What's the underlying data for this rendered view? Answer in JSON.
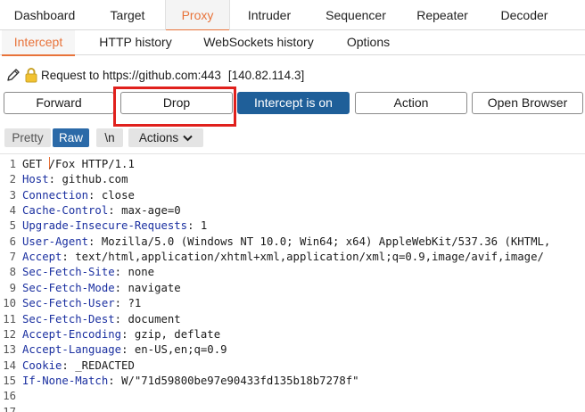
{
  "tabs_primary": [
    {
      "label": "Dashboard"
    },
    {
      "label": "Target"
    },
    {
      "label": "Proxy",
      "active": true
    },
    {
      "label": "Intruder"
    },
    {
      "label": "Sequencer"
    },
    {
      "label": "Repeater"
    },
    {
      "label": "Decoder"
    }
  ],
  "tabs_secondary": [
    {
      "label": "Intercept",
      "active": true
    },
    {
      "label": "HTTP history"
    },
    {
      "label": "WebSockets history"
    },
    {
      "label": "Options"
    }
  ],
  "request_info": {
    "label": "Request to https://github.com:443",
    "ip": "[140.82.114.3]"
  },
  "buttons": {
    "forward": "Forward",
    "drop": "Drop",
    "intercept": "Intercept is on",
    "action": "Action",
    "open_browser": "Open Browser"
  },
  "toolbar": {
    "pretty": "Pretty",
    "raw": "Raw",
    "newline": "\\n",
    "actions": "Actions"
  },
  "colors": {
    "accent": "#e8733a",
    "primary_button": "#1f5f99",
    "highlight_box": "#e0201c",
    "header_name": "#1a2fa0"
  },
  "request_lines": [
    {
      "n": "1",
      "text": "GET /Fox HTTP/1.1"
    },
    {
      "n": "2",
      "key": "Host",
      "val": "github.com"
    },
    {
      "n": "3",
      "key": "Connection",
      "val": "close"
    },
    {
      "n": "4",
      "key": "Cache-Control",
      "val": "max-age=0"
    },
    {
      "n": "5",
      "key": "Upgrade-Insecure-Requests",
      "val": "1"
    },
    {
      "n": "6",
      "key": "User-Agent",
      "val": "Mozilla/5.0 (Windows NT 10.0; Win64; x64) AppleWebKit/537.36 (KHTML,"
    },
    {
      "n": "7",
      "key": "Accept",
      "val": "text/html,application/xhtml+xml,application/xml;q=0.9,image/avif,image/"
    },
    {
      "n": "8",
      "key": "Sec-Fetch-Site",
      "val": "none"
    },
    {
      "n": "9",
      "key": "Sec-Fetch-Mode",
      "val": "navigate"
    },
    {
      "n": "10",
      "key": "Sec-Fetch-User",
      "val": "?1"
    },
    {
      "n": "11",
      "key": "Sec-Fetch-Dest",
      "val": "document"
    },
    {
      "n": "12",
      "key": "Accept-Encoding",
      "val": "gzip, deflate"
    },
    {
      "n": "13",
      "key": "Accept-Language",
      "val": "en-US,en;q=0.9"
    },
    {
      "n": "14",
      "key": "Cookie",
      "val": "_REDACTED"
    },
    {
      "n": "15",
      "key": "If-None-Match",
      "val": "W/\"71d59800be97e90433fd135b18b7278f\""
    },
    {
      "n": "16",
      "text": ""
    },
    {
      "n": "17",
      "text": ""
    }
  ]
}
